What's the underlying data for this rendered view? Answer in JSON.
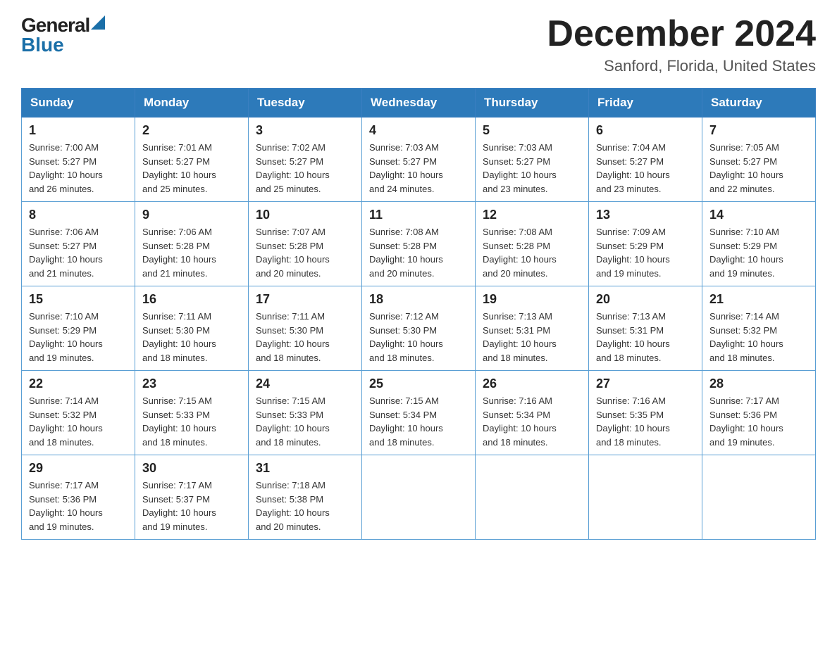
{
  "header": {
    "logo_general": "General",
    "logo_blue": "Blue",
    "month_title": "December 2024",
    "location": "Sanford, Florida, United States"
  },
  "days_of_week": [
    "Sunday",
    "Monday",
    "Tuesday",
    "Wednesday",
    "Thursday",
    "Friday",
    "Saturday"
  ],
  "weeks": [
    [
      {
        "day": "1",
        "sunrise": "7:00 AM",
        "sunset": "5:27 PM",
        "daylight": "10 hours and 26 minutes."
      },
      {
        "day": "2",
        "sunrise": "7:01 AM",
        "sunset": "5:27 PM",
        "daylight": "10 hours and 25 minutes."
      },
      {
        "day": "3",
        "sunrise": "7:02 AM",
        "sunset": "5:27 PM",
        "daylight": "10 hours and 25 minutes."
      },
      {
        "day": "4",
        "sunrise": "7:03 AM",
        "sunset": "5:27 PM",
        "daylight": "10 hours and 24 minutes."
      },
      {
        "day": "5",
        "sunrise": "7:03 AM",
        "sunset": "5:27 PM",
        "daylight": "10 hours and 23 minutes."
      },
      {
        "day": "6",
        "sunrise": "7:04 AM",
        "sunset": "5:27 PM",
        "daylight": "10 hours and 23 minutes."
      },
      {
        "day": "7",
        "sunrise": "7:05 AM",
        "sunset": "5:27 PM",
        "daylight": "10 hours and 22 minutes."
      }
    ],
    [
      {
        "day": "8",
        "sunrise": "7:06 AM",
        "sunset": "5:27 PM",
        "daylight": "10 hours and 21 minutes."
      },
      {
        "day": "9",
        "sunrise": "7:06 AM",
        "sunset": "5:28 PM",
        "daylight": "10 hours and 21 minutes."
      },
      {
        "day": "10",
        "sunrise": "7:07 AM",
        "sunset": "5:28 PM",
        "daylight": "10 hours and 20 minutes."
      },
      {
        "day": "11",
        "sunrise": "7:08 AM",
        "sunset": "5:28 PM",
        "daylight": "10 hours and 20 minutes."
      },
      {
        "day": "12",
        "sunrise": "7:08 AM",
        "sunset": "5:28 PM",
        "daylight": "10 hours and 20 minutes."
      },
      {
        "day": "13",
        "sunrise": "7:09 AM",
        "sunset": "5:29 PM",
        "daylight": "10 hours and 19 minutes."
      },
      {
        "day": "14",
        "sunrise": "7:10 AM",
        "sunset": "5:29 PM",
        "daylight": "10 hours and 19 minutes."
      }
    ],
    [
      {
        "day": "15",
        "sunrise": "7:10 AM",
        "sunset": "5:29 PM",
        "daylight": "10 hours and 19 minutes."
      },
      {
        "day": "16",
        "sunrise": "7:11 AM",
        "sunset": "5:30 PM",
        "daylight": "10 hours and 18 minutes."
      },
      {
        "day": "17",
        "sunrise": "7:11 AM",
        "sunset": "5:30 PM",
        "daylight": "10 hours and 18 minutes."
      },
      {
        "day": "18",
        "sunrise": "7:12 AM",
        "sunset": "5:30 PM",
        "daylight": "10 hours and 18 minutes."
      },
      {
        "day": "19",
        "sunrise": "7:13 AM",
        "sunset": "5:31 PM",
        "daylight": "10 hours and 18 minutes."
      },
      {
        "day": "20",
        "sunrise": "7:13 AM",
        "sunset": "5:31 PM",
        "daylight": "10 hours and 18 minutes."
      },
      {
        "day": "21",
        "sunrise": "7:14 AM",
        "sunset": "5:32 PM",
        "daylight": "10 hours and 18 minutes."
      }
    ],
    [
      {
        "day": "22",
        "sunrise": "7:14 AM",
        "sunset": "5:32 PM",
        "daylight": "10 hours and 18 minutes."
      },
      {
        "day": "23",
        "sunrise": "7:15 AM",
        "sunset": "5:33 PM",
        "daylight": "10 hours and 18 minutes."
      },
      {
        "day": "24",
        "sunrise": "7:15 AM",
        "sunset": "5:33 PM",
        "daylight": "10 hours and 18 minutes."
      },
      {
        "day": "25",
        "sunrise": "7:15 AM",
        "sunset": "5:34 PM",
        "daylight": "10 hours and 18 minutes."
      },
      {
        "day": "26",
        "sunrise": "7:16 AM",
        "sunset": "5:34 PM",
        "daylight": "10 hours and 18 minutes."
      },
      {
        "day": "27",
        "sunrise": "7:16 AM",
        "sunset": "5:35 PM",
        "daylight": "10 hours and 18 minutes."
      },
      {
        "day": "28",
        "sunrise": "7:17 AM",
        "sunset": "5:36 PM",
        "daylight": "10 hours and 19 minutes."
      }
    ],
    [
      {
        "day": "29",
        "sunrise": "7:17 AM",
        "sunset": "5:36 PM",
        "daylight": "10 hours and 19 minutes."
      },
      {
        "day": "30",
        "sunrise": "7:17 AM",
        "sunset": "5:37 PM",
        "daylight": "10 hours and 19 minutes."
      },
      {
        "day": "31",
        "sunrise": "7:18 AM",
        "sunset": "5:38 PM",
        "daylight": "10 hours and 20 minutes."
      },
      null,
      null,
      null,
      null
    ]
  ],
  "labels": {
    "sunrise": "Sunrise:",
    "sunset": "Sunset:",
    "daylight": "Daylight:"
  },
  "colors": {
    "header_bg": "#2d7aba",
    "border": "#5a9fd4",
    "logo_blue": "#1a6fa8"
  }
}
